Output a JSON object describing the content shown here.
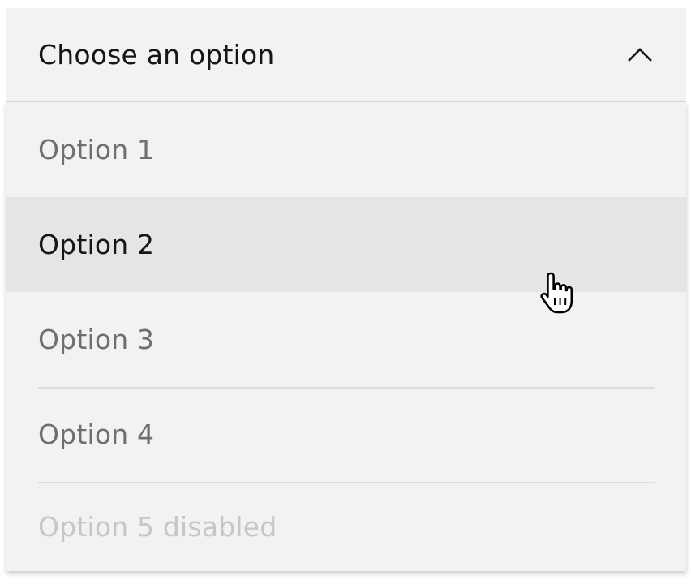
{
  "dropdown": {
    "placeholder": "Choose an option",
    "expanded": true,
    "toggle_icon": "chevron-up-icon",
    "options": [
      {
        "label": "Option 1",
        "state": "default"
      },
      {
        "label": "Option 2",
        "state": "hover"
      },
      {
        "label": "Option 3",
        "state": "default"
      },
      {
        "label": "Option 4",
        "state": "default"
      },
      {
        "label": "Option 5 disabled",
        "state": "disabled"
      }
    ]
  },
  "cursor": {
    "icon": "hand-pointer-icon"
  },
  "colors": {
    "field_background": "#f2f2f2",
    "hover_background": "#e5e5e5",
    "text_primary": "#161616",
    "text_secondary": "#6f6f6f",
    "text_disabled": "#c6c6c6",
    "divider": "#dcdcdc"
  }
}
